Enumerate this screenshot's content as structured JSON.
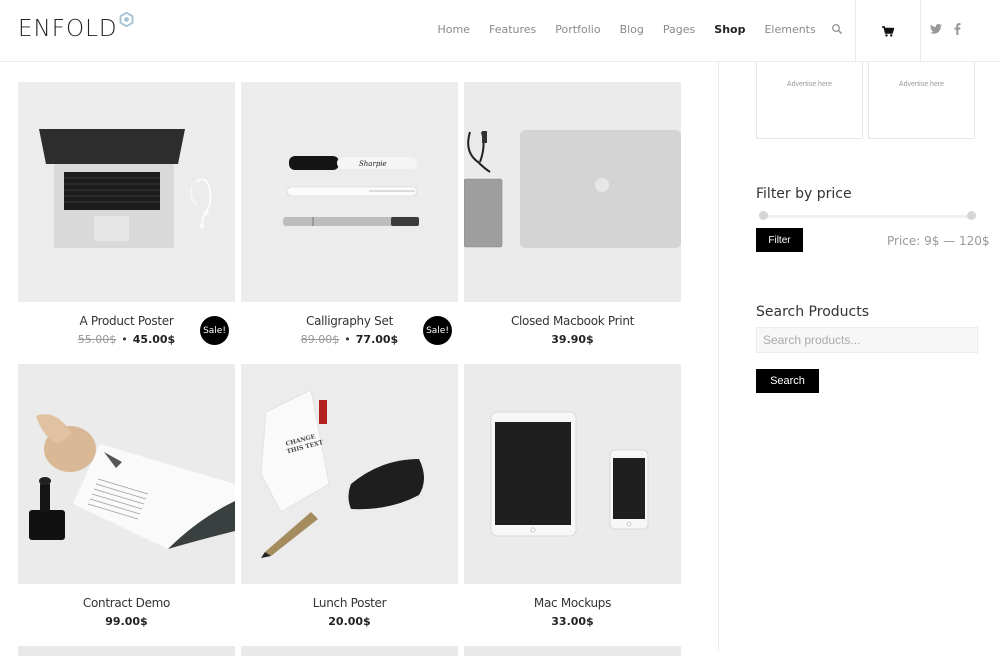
{
  "header": {
    "logo": "ENFOLD",
    "nav": [
      {
        "label": "Home",
        "active": false
      },
      {
        "label": "Features",
        "active": false
      },
      {
        "label": "Portfolio",
        "active": false
      },
      {
        "label": "Blog",
        "active": false
      },
      {
        "label": "Pages",
        "active": false
      },
      {
        "label": "Shop",
        "active": true
      },
      {
        "label": "Elements",
        "active": false
      }
    ],
    "icons": [
      "search-icon",
      "cart-icon",
      "twitter-icon",
      "facebook-icon"
    ]
  },
  "products": [
    {
      "title": "A Product Poster",
      "old_price": "55.00$",
      "price": "45.00$",
      "sale": "Sale!",
      "image": "laptop-with-earphones"
    },
    {
      "title": "Calligraphy Set",
      "old_price": "89.00$",
      "price": "77.00$",
      "sale": "Sale!",
      "image": "pens-set"
    },
    {
      "title": "Closed Macbook Print",
      "price": "39.90$",
      "image": "closed-macbook-hdd"
    },
    {
      "title": "Contract Demo",
      "price": "99.00$",
      "image": "contract-stamp"
    },
    {
      "title": "Lunch Poster",
      "price": "20.00$",
      "image": "lunch-bag-pencil"
    },
    {
      "title": "Mac Mockups",
      "price": "33.00$",
      "image": "ipad-iphone"
    }
  ],
  "sidebar": {
    "ads": [
      "Advertise here",
      "Advertise here"
    ],
    "filter": {
      "title": "Filter by price",
      "button": "Filter",
      "price_label": "Price: 9$ — 120$",
      "min": 9,
      "max": 120
    },
    "search": {
      "title": "Search Products",
      "placeholder": "Search products...",
      "button": "Search"
    }
  }
}
